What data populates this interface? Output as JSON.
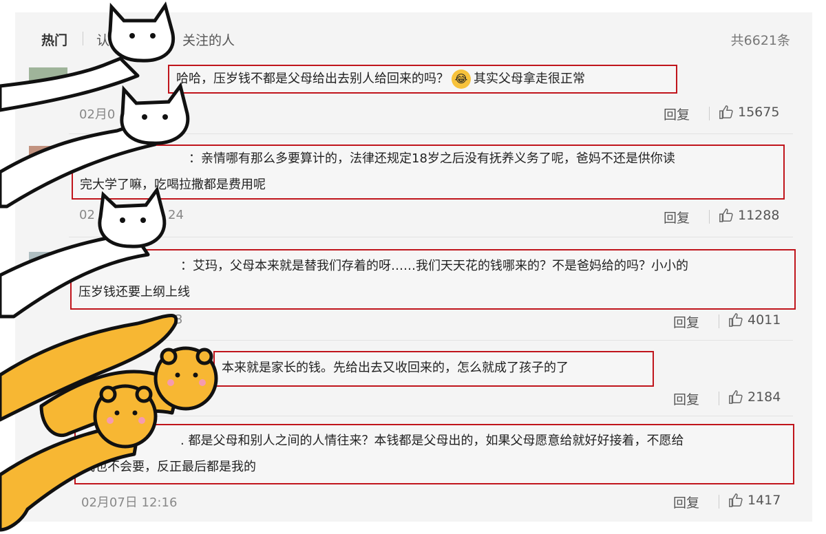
{
  "tabs": [
    "热门",
    "认",
    "关注的人"
  ],
  "total": "共6621条",
  "comments": [
    {
      "text": "哈哈，压岁钱不都是父母给出去别人给回来的吗？",
      "text2": "其实父母拿走很正常",
      "emoji": "😂",
      "time": "02月0",
      "reply": "回复",
      "likes": "15675"
    },
    {
      "line1": "：亲情哪有那么多要算计的，法律还规定18岁之后没有抚养义务了呢，爸妈不还是供你读",
      "line2": "完大学了嘛，吃喝拉撒都是费用呢",
      "time": "02",
      "time_tail": "24",
      "reply": "回复",
      "likes": "11288"
    },
    {
      "line1": "：艾玛，父母本来就是替我们存着的呀……我们天天花的钱哪来的？不是爸妈给的吗？小小的",
      "line2": "压岁钱还要上纲上线",
      "time": "3",
      "reply": "回复",
      "likes": "4011"
    },
    {
      "text": "本来就是家长的钱。先给出去又收回来的，怎么就成了孩子的了",
      "reply": "回复",
      "likes": "2184"
    },
    {
      "line1": ".  都是父母和别人之间的人情往来？本钱都是父母出的，如果父母愿意给就好好接着，不愿给",
      "line2": "我也不会要，反正最后都是我的",
      "time": "02月07日 12:16",
      "reply": "回复",
      "likes": "1417"
    }
  ],
  "colors": {
    "highlight": "#c0141b",
    "sticker_cat": "#ffffff",
    "sticker_bear": "#f7b733"
  },
  "icons": {
    "like": "thumbs-up-icon",
    "cat": "cat-sticker",
    "bear": "bear-sticker"
  }
}
